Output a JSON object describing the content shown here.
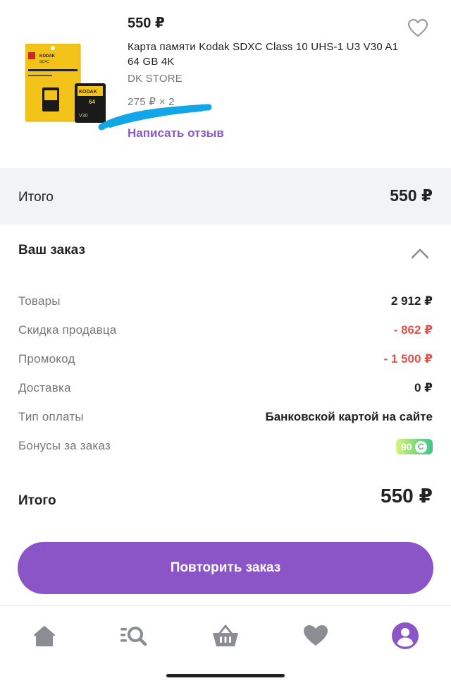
{
  "product": {
    "price": "550 ₽",
    "title": "Карта памяти Kodak SDXC Class 10 UHS-1 U3 V30 A1 64 GB 4K",
    "store": "DK STORE",
    "unit_price": "275 ₽ × 2",
    "review_link": "Написать отзыв",
    "image_brand": "KODAK",
    "image_caption": "SDXC",
    "image_capacity": "64GB"
  },
  "total_band": {
    "label": "Итого",
    "value": "550 ₽"
  },
  "order": {
    "title": "Ваш заказ",
    "rows": [
      {
        "label": "Товары",
        "value": "2 912 ₽"
      },
      {
        "label": "Скидка продавца",
        "value": "- 862 ₽"
      },
      {
        "label": "Промокод",
        "value": "- 1 500 ₽"
      },
      {
        "label": "Доставка",
        "value": "0 ₽"
      },
      {
        "label": "Тип оплаты",
        "value": "Банковской картой на сайте"
      },
      {
        "label": "Бонусы за заказ",
        "value": "90"
      }
    ],
    "final_label": "Итого",
    "final_value": "550 ₽",
    "repeat_button": "Повторить заказ"
  },
  "colors": {
    "accent": "#8c55c7",
    "discount": "#e0524a",
    "nav_icon": "#8a8d93"
  },
  "nav": {
    "items": [
      "home-icon",
      "catalog-search-icon",
      "basket-icon",
      "favorites-icon",
      "profile-icon"
    ],
    "active": "profile-icon"
  }
}
